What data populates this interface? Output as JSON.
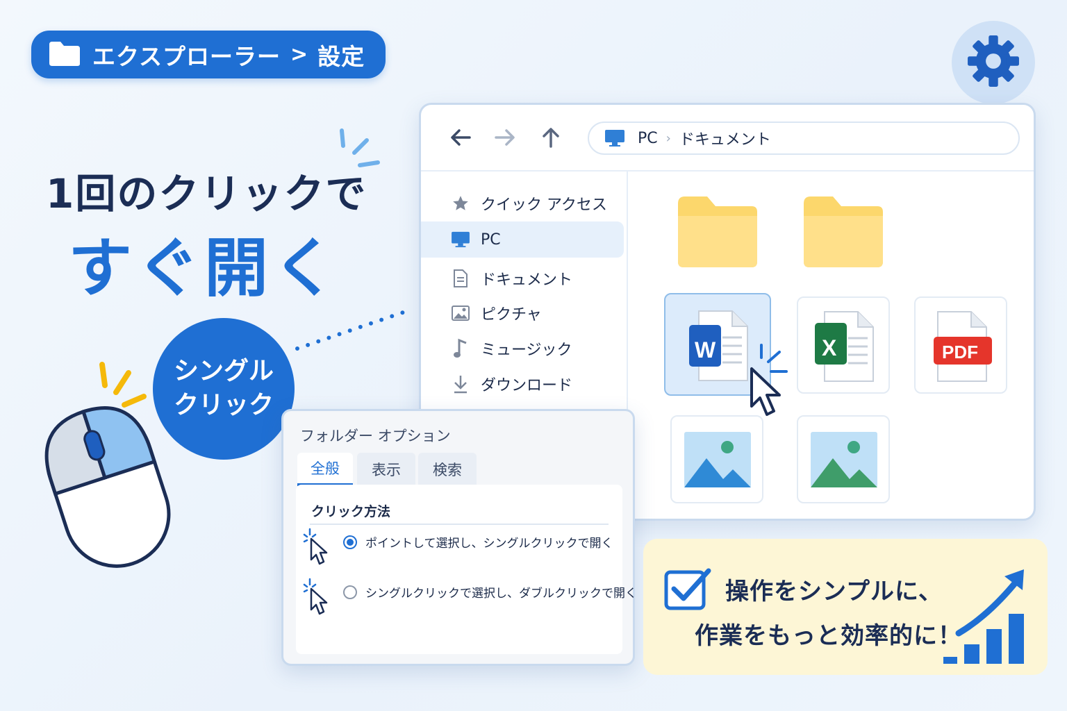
{
  "breadcrumb": {
    "app": "エクスプローラー",
    "separator": ">",
    "page": "設定"
  },
  "headline": {
    "line1": "1回のクリックで",
    "line2": "すぐ開く"
  },
  "bubble": {
    "line1": "シングル",
    "line2": "クリック"
  },
  "explorer": {
    "address": {
      "root": "PC",
      "folder": "ドキュメント"
    },
    "sidebar": [
      {
        "label": "クイック アクセス",
        "icon": "star-icon"
      },
      {
        "label": "PC",
        "icon": "monitor-icon",
        "active": true
      },
      {
        "label": "ドキュメント",
        "icon": "document-icon"
      },
      {
        "label": "ピクチャ",
        "icon": "picture-icon"
      },
      {
        "label": "ミュージック",
        "icon": "music-note-icon"
      },
      {
        "label": "ダウンロード",
        "icon": "download-icon"
      }
    ],
    "files": {
      "word_letter": "W",
      "excel_letter": "X",
      "pdf_label": "PDF"
    }
  },
  "dialog": {
    "title": "フォルダー オプション",
    "tabs": [
      "全般",
      "表示",
      "検索"
    ],
    "active_tab": "全般",
    "section": "クリック方法",
    "options": [
      {
        "label": "ポイントして選択し、シングルクリックで開く",
        "selected": true
      },
      {
        "label": "シングルクリックで選択し、ダブルクリックで開く",
        "selected": false
      }
    ]
  },
  "callout": {
    "line1": "操作をシンプルに、",
    "line2": "作業をもっと効率的に！"
  },
  "colors": {
    "accent": "#1f6fd3",
    "navy": "#1b2d55",
    "folder": "#fcd76c",
    "word": "#1f5fbf",
    "excel": "#1e7a45",
    "pdf": "#e5352b",
    "callout_bg": "#fdf6d6"
  }
}
